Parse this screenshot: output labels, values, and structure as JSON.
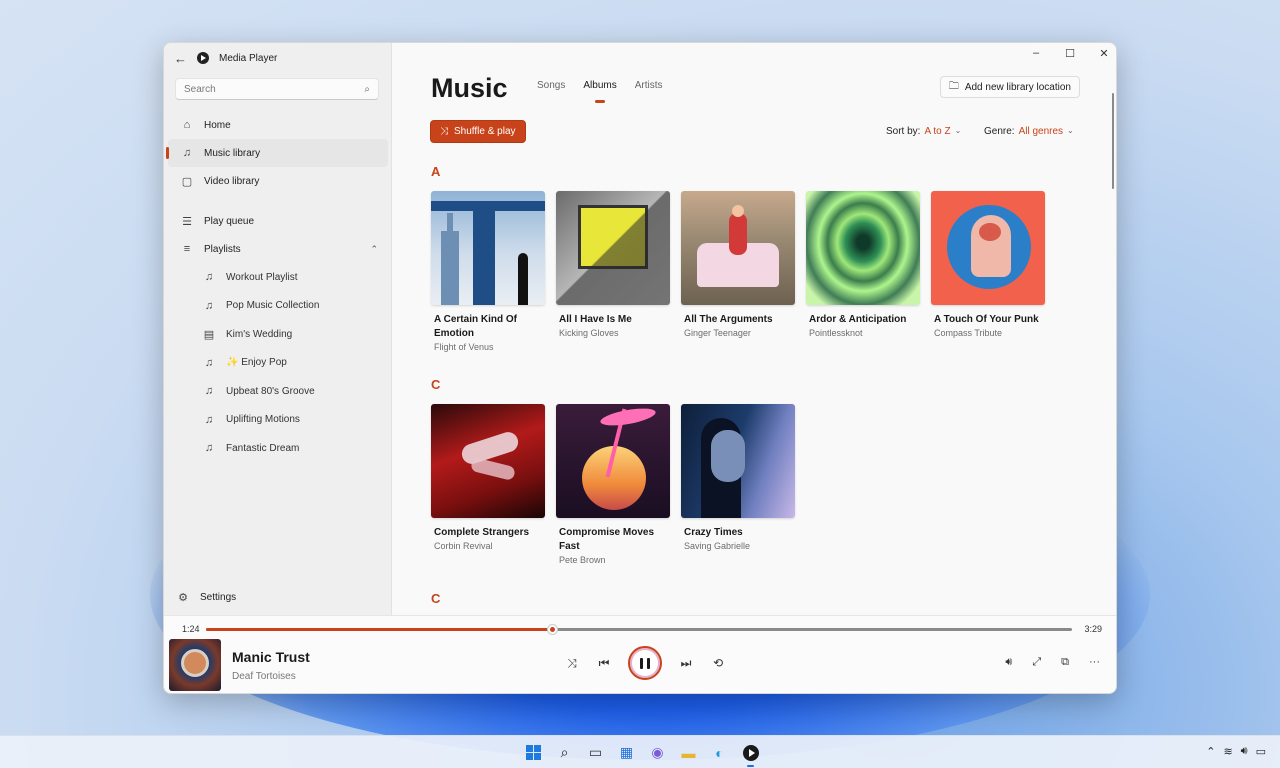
{
  "app": {
    "title": "Media Player"
  },
  "search": {
    "placeholder": "Search"
  },
  "nav": {
    "items": [
      {
        "label": "Home"
      },
      {
        "label": "Music library"
      },
      {
        "label": "Video library"
      },
      {
        "label": "Play queue"
      },
      {
        "label": "Playlists"
      }
    ],
    "playlists": [
      {
        "label": "Workout Playlist"
      },
      {
        "label": "Pop Music Collection"
      },
      {
        "label": "Kim's Wedding"
      },
      {
        "label": "✨ Enjoy Pop"
      },
      {
        "label": "Upbeat 80's Groove"
      },
      {
        "label": "Uplifting Motions"
      },
      {
        "label": "Fantastic Dream"
      }
    ],
    "settings": "Settings"
  },
  "main": {
    "title": "Music",
    "tabs": [
      {
        "label": "Songs"
      },
      {
        "label": "Albums"
      },
      {
        "label": "Artists"
      }
    ],
    "active_tab": "Albums",
    "add_library": "Add new library location",
    "shuffle": "Shuffle & play",
    "sort_label": "Sort by:",
    "sort_value": "A to Z",
    "genre_label": "Genre:",
    "genre_value": "All genres",
    "sections": [
      {
        "letter": "A",
        "albums": [
          {
            "title": "A Certain Kind Of Emotion",
            "artist": "Flight of Venus"
          },
          {
            "title": "All I Have Is Me",
            "artist": "Kicking Gloves"
          },
          {
            "title": "All The Arguments",
            "artist": "Ginger Teenager"
          },
          {
            "title": "Ardor & Anticipation",
            "artist": "Pointlessknot"
          },
          {
            "title": "A Touch Of Your Punk",
            "artist": "Compass Tribute"
          }
        ]
      },
      {
        "letter": "C",
        "albums": [
          {
            "title": "Complete Strangers",
            "artist": "Corbin Revival"
          },
          {
            "title": "Compromise Moves Fast",
            "artist": "Pete Brown"
          },
          {
            "title": "Crazy Times",
            "artist": "Saving Gabrielle"
          }
        ]
      },
      {
        "letter": "C",
        "albums": []
      }
    ]
  },
  "player": {
    "elapsed": "1:24",
    "duration": "3:29",
    "progress_fraction": 0.4,
    "track": "Manic Trust",
    "artist": "Deaf Tortoises",
    "state": "playing"
  },
  "colors": {
    "accent": "#c8431a"
  },
  "icons": {
    "taskbar": [
      "windows-start-icon",
      "search-icon",
      "task-view-icon",
      "widgets-icon",
      "chat-icon",
      "file-explorer-icon",
      "edge-icon",
      "media-player-icon"
    ],
    "tray": [
      "chevron-up-icon",
      "wifi-icon",
      "volume-icon",
      "battery-icon"
    ]
  }
}
